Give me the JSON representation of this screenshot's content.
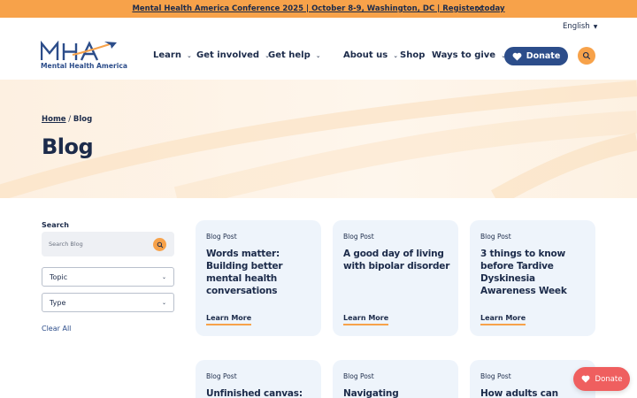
{
  "announcement": {
    "text": "Mental Health America Conference 2025 | October 8-9, Washington, DC | Register today",
    "close": "×"
  },
  "header": {
    "language": "English",
    "logo_letters": "MHA",
    "logo_name": "Mental Health America",
    "nav": [
      {
        "label": "Learn",
        "has_dropdown": true
      },
      {
        "label": "Get involved",
        "has_dropdown": true
      },
      {
        "label": "Get help",
        "has_dropdown": true
      },
      {
        "label": "About us",
        "has_dropdown": true
      },
      {
        "label": "Shop",
        "has_dropdown": false
      },
      {
        "label": "Ways to give",
        "has_dropdown": true
      }
    ],
    "donate_label": "Donate",
    "search_icon": "search-icon"
  },
  "hero": {
    "breadcrumb_home": "Home",
    "breadcrumb_sep": "/",
    "breadcrumb_current": "Blog",
    "title": "Blog"
  },
  "sidebar": {
    "search_label": "Search",
    "search_placeholder": "Search Blog",
    "topic_label": "Topic",
    "type_label": "Type",
    "clear_all": "Clear All"
  },
  "cards": [
    {
      "tag": "Blog Post",
      "title": "Words matter: Building better mental health conversations",
      "link": "Learn More"
    },
    {
      "tag": "Blog Post",
      "title": "A good day of living with bipolar disorder",
      "link": "Learn More"
    },
    {
      "tag": "Blog Post",
      "title": "3 things to know before Tardive Dyskinesia Awareness Week",
      "link": "Learn More"
    },
    {
      "tag": "Blog Post",
      "title": "Unfinished canvas:",
      "link": ""
    },
    {
      "tag": "Blog Post",
      "title": "Navigating",
      "link": ""
    },
    {
      "tag": "Blog Post",
      "title": "How adults can",
      "link": ""
    }
  ],
  "floating_donate": "Donate",
  "colors": {
    "navy": "#1c2b4a",
    "brand_blue": "#2c4d8a",
    "orange": "#f7a24a",
    "card_bg": "#eef4fb",
    "float_donate": "#ef5f5f"
  }
}
